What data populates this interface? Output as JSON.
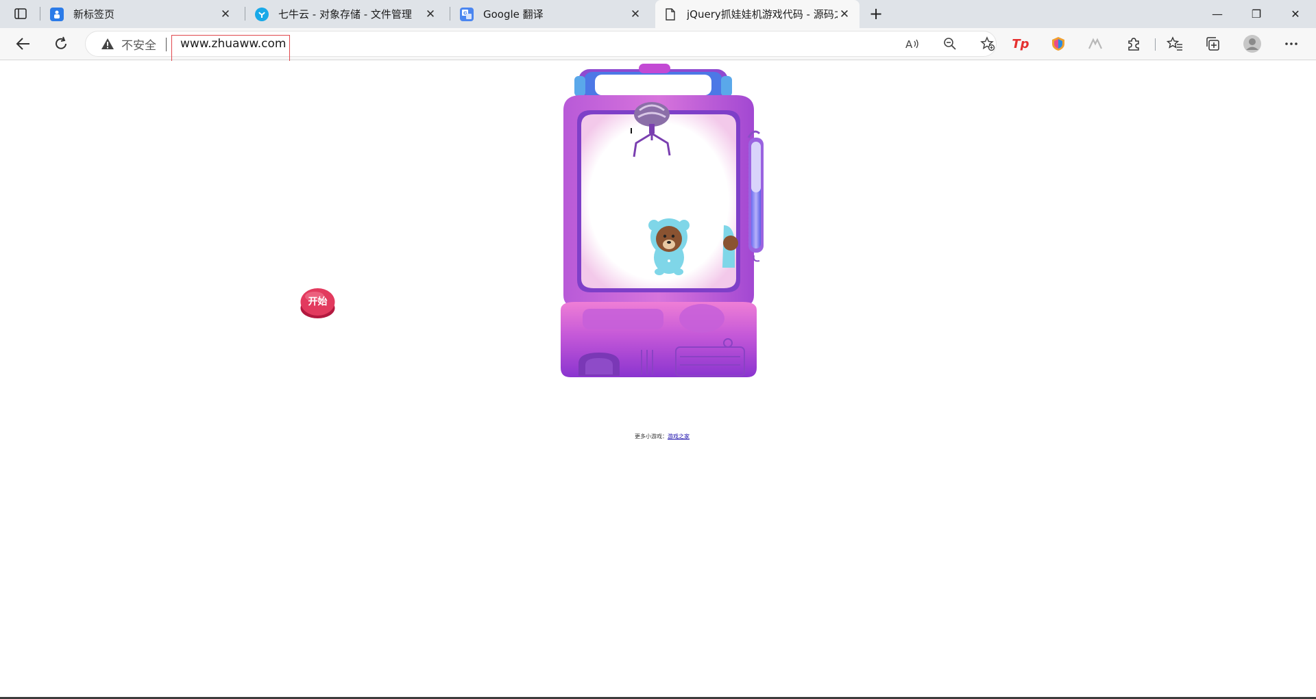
{
  "browser": {
    "tabs": [
      {
        "title": "新标签页",
        "favicon": "new-tab-icon",
        "active": false
      },
      {
        "title": "七牛云 - 对象存储 - 文件管理",
        "favicon": "qiniu-cloud-icon",
        "active": false
      },
      {
        "title": "Google 翻译",
        "favicon": "google-translate-icon",
        "active": false
      },
      {
        "title": "jQuery抓娃娃机游戏代码 - 源码之",
        "favicon": "page-icon",
        "active": true
      }
    ],
    "new_tab_symbol": "+",
    "close_symbol": "✕",
    "window_controls": {
      "minimize": "—",
      "restore": "❐",
      "close": "✕"
    }
  },
  "toolbar": {
    "insecure_label": "不安全",
    "url": "www.zhuaww.com",
    "extension_tp_label": "Tp"
  },
  "page": {
    "start_button_label": "开始",
    "footer_prefix": "更多小游戏：",
    "footer_link": "游戏之家"
  },
  "colors": {
    "machine_purple": "#9b3fd6",
    "machine_pink": "#e46fd0",
    "start_red": "#e23a5e",
    "highlight_red": "#e0474c",
    "link_blue": "#1a0dab"
  }
}
